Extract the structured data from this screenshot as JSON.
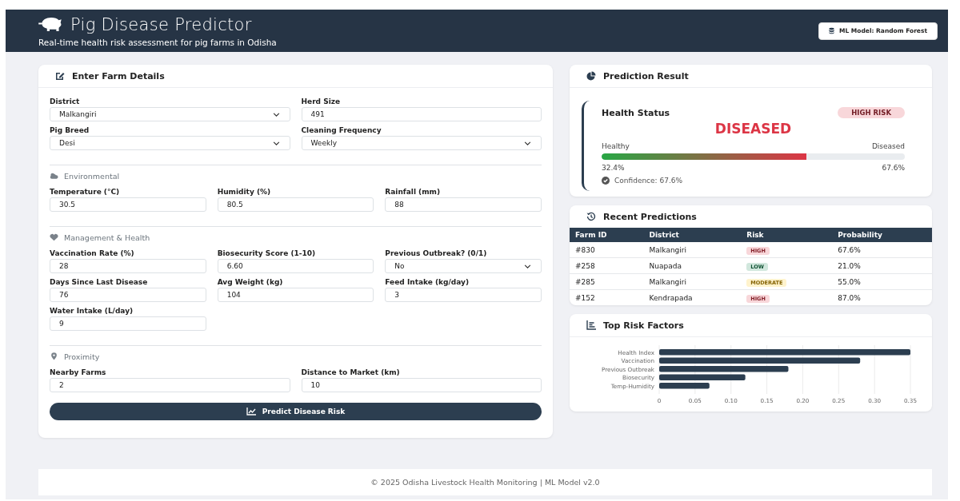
{
  "header": {
    "title": "Pig Disease Predictor",
    "subtitle": "Real-time health risk assessment for pig farms in Odisha",
    "model_button": "ML Model: Random Forest"
  },
  "form": {
    "title": "Enter Farm Details",
    "sections": [
      {
        "fields": [
          {
            "label": "District",
            "value": "Malkangiri",
            "kind": "select"
          },
          {
            "label": "Herd Size",
            "value": "491",
            "kind": "input"
          },
          {
            "label": "Pig Breed",
            "value": "Desi",
            "kind": "select"
          },
          {
            "label": "Cleaning Frequency",
            "value": "Weekly",
            "kind": "select"
          }
        ]
      },
      {
        "title": "Environmental",
        "fields": [
          {
            "label": "Temperature (°C)",
            "value": "30.5",
            "kind": "input"
          },
          {
            "label": "Humidity (%)",
            "value": "80.5",
            "kind": "input"
          },
          {
            "label": "Rainfall (mm)",
            "value": "88",
            "kind": "input"
          }
        ]
      },
      {
        "title": "Management & Health",
        "fields": [
          {
            "label": "Vaccination Rate (%)",
            "value": "28",
            "kind": "input"
          },
          {
            "label": "Biosecurity Score (1-10)",
            "value": "6.60",
            "kind": "input"
          },
          {
            "label": "Previous Outbreak? (0/1)",
            "value": "No",
            "kind": "select"
          },
          {
            "label": "Days Since Last Disease",
            "value": "76",
            "kind": "input"
          },
          {
            "label": "Avg Weight (kg)",
            "value": "104",
            "kind": "input"
          },
          {
            "label": "Feed Intake (kg/day)",
            "value": "3",
            "kind": "input"
          },
          {
            "label": "Water Intake (L/day)",
            "value": "9",
            "kind": "input"
          }
        ]
      },
      {
        "title": "Proximity",
        "fields": [
          {
            "label": "Nearby Farms",
            "value": "2",
            "kind": "input"
          },
          {
            "label": "Distance to Market (km)",
            "value": "10",
            "kind": "input"
          }
        ]
      }
    ],
    "submit": "Predict Disease Risk"
  },
  "prediction": {
    "title": "Prediction Result",
    "status_label": "Health Status",
    "risk_badge": "HIGH RISK",
    "status": "DISEASED",
    "left_label": "Healthy",
    "right_label": "Diseased",
    "level": 0.676,
    "left_value": "32.4%",
    "right_value": "67.6%",
    "confidence": "Confidence: 67.6%"
  },
  "recent": {
    "title": "Recent Predictions",
    "columns": [
      "Farm ID",
      "District",
      "Risk",
      "Probability"
    ],
    "rows": [
      {
        "id": "#830",
        "district": "Malkangiri",
        "risk": "HIGH",
        "kind": "high",
        "probability": "67.6%"
      },
      {
        "id": "#258",
        "district": "Nuapada",
        "risk": "LOW",
        "kind": "low",
        "probability": "21.0%"
      },
      {
        "id": "#285",
        "district": "Malkangiri",
        "risk": "MODERATE",
        "kind": "moderate",
        "probability": "55.0%"
      },
      {
        "id": "#152",
        "district": "Kendrapada",
        "risk": "HIGH",
        "kind": "high",
        "probability": "87.0%"
      }
    ]
  },
  "factors": {
    "title": "Top Risk Factors",
    "chart_data": {
      "type": "bar",
      "orientation": "horizontal",
      "grid": true,
      "categories": [
        "Health Index",
        "Vaccination",
        "Previous Outbreak",
        "Biosecurity",
        "Temp-Humidity"
      ],
      "values": [
        0.35,
        0.28,
        0.18,
        0.12,
        0.07
      ],
      "xlim": [
        0,
        0.35
      ],
      "xticks": [
        {
          "value": 0,
          "label": "0"
        },
        {
          "value": 0.05,
          "label": "0.05"
        },
        {
          "value": 0.1,
          "label": "0.10"
        },
        {
          "value": 0.15,
          "label": "0.15"
        },
        {
          "value": 0.2,
          "label": "0.20"
        },
        {
          "value": 0.25,
          "label": "0.25"
        },
        {
          "value": 0.3,
          "label": "0.30"
        },
        {
          "value": 0.35,
          "label": "0.35"
        }
      ]
    }
  },
  "footer": "© 2025 Odisha Livestock Health Monitoring | ML Model v2.0"
}
